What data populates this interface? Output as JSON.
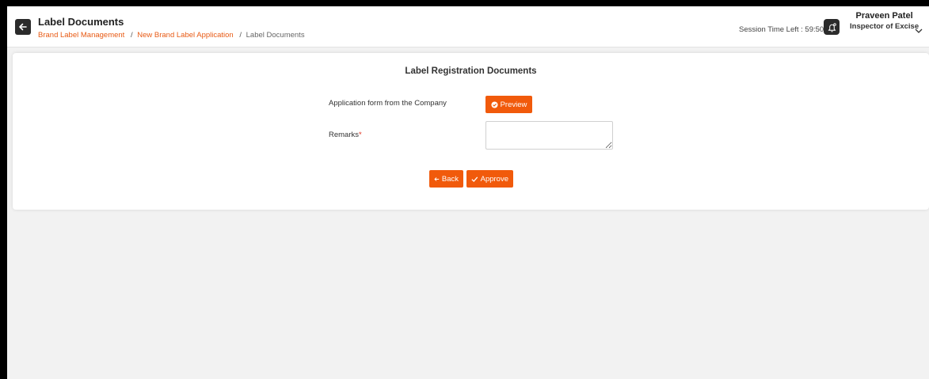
{
  "header": {
    "title": "Label Documents",
    "breadcrumb": {
      "items": [
        "Brand Label Management",
        "New Brand Label Application"
      ],
      "separator": "/",
      "current": "Label Documents"
    },
    "session_text": "Session Time Left : 59:50",
    "user": {
      "name": "Praveen Patel",
      "role": "Inspector of Excise"
    }
  },
  "main": {
    "title": "Label Registration Documents",
    "application_form_label": "Application form from the Company",
    "preview_label": "Preview",
    "remarks_label": "Remarks",
    "remarks_required": "*",
    "remarks_value": "",
    "back_label": "Back",
    "approve_label": "Approve"
  },
  "icons": {
    "back": "arrow-left-icon",
    "bell": "bell-icon",
    "chevron": "chevron-down-icon",
    "preview": "eye-icon",
    "back_button": "arrow-left-icon",
    "approve": "check-icon"
  },
  "colors": {
    "accent": "#f15a0b",
    "link": "#e85a14",
    "dark_button": "#2b2b2b",
    "background": "#f2f2f2"
  }
}
